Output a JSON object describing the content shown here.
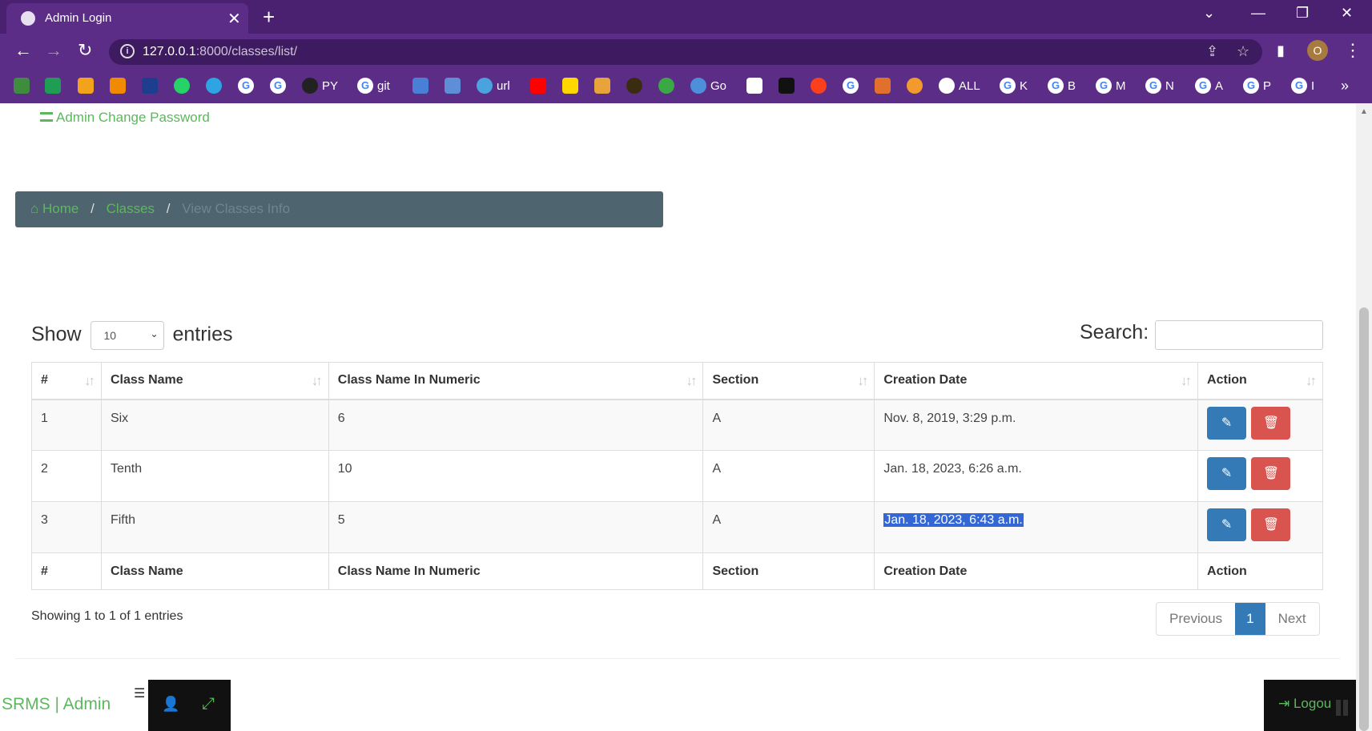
{
  "browser": {
    "tab_title": "Admin Login",
    "tab_close": "✕",
    "new_tab": "+",
    "url_host": "127.0.0.1",
    "url_path": ":8000/classes/list/",
    "profile_initial": "O",
    "bookmarks": [
      "PY",
      "git",
      "url",
      "Go",
      "ALL",
      "K",
      "B",
      "M",
      "N",
      "A",
      "P",
      "I"
    ],
    "more": "»"
  },
  "sidebar": {
    "change_password": "Admin Change Password"
  },
  "breadcrumb": {
    "home": "Home",
    "sep": "/",
    "classes": "Classes",
    "current": "View Classes Info"
  },
  "table_controls": {
    "show_label": "Show",
    "entries_label": "entries",
    "page_size": "10",
    "search_label": "Search:"
  },
  "table": {
    "headers": [
      "#",
      "Class Name",
      "Class Name In Numeric",
      "Section",
      "Creation Date",
      "Action"
    ],
    "rows": [
      {
        "num": "1",
        "name": "Six",
        "numeric": "6",
        "section": "A",
        "date": "Nov. 8, 2019, 3:29 p.m."
      },
      {
        "num": "2",
        "name": "Tenth",
        "numeric": "10",
        "section": "A",
        "date": "Jan. 18, 2023, 6:26 a.m."
      },
      {
        "num": "3",
        "name": "Fifth",
        "numeric": "5",
        "section": "A",
        "date": "Jan. 18, 2023, 6:43 a.m."
      }
    ]
  },
  "pagination": {
    "info": "Showing 1 to 1 of 1 entries",
    "previous": "Previous",
    "current": "1",
    "next": "Next"
  },
  "footer": {
    "brand": "SRMS | Admin",
    "logout": "Logou"
  },
  "colors": {
    "brand_green": "#5cb85c",
    "edit_blue": "#337ab7",
    "delete_red": "#d9534f",
    "breadcrumb_bg": "#4e646f",
    "chrome_purple": "#5b2d86"
  }
}
